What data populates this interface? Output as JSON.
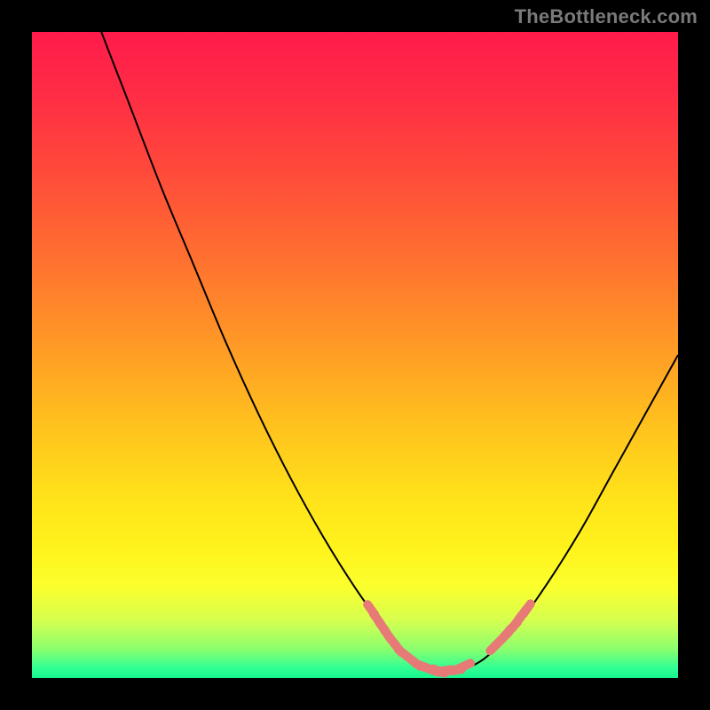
{
  "attribution": "TheBottleneck.com",
  "gradient": {
    "stops": [
      {
        "offset": 0.0,
        "color": "#ff1b4b"
      },
      {
        "offset": 0.1,
        "color": "#ff2d45"
      },
      {
        "offset": 0.22,
        "color": "#ff4b3a"
      },
      {
        "offset": 0.35,
        "color": "#ff7030"
      },
      {
        "offset": 0.48,
        "color": "#ff9826"
      },
      {
        "offset": 0.6,
        "color": "#ffbf1e"
      },
      {
        "offset": 0.72,
        "color": "#ffe21a"
      },
      {
        "offset": 0.8,
        "color": "#fff31c"
      },
      {
        "offset": 0.86,
        "color": "#fbff2e"
      },
      {
        "offset": 0.91,
        "color": "#d6ff4f"
      },
      {
        "offset": 0.955,
        "color": "#8cff6e"
      },
      {
        "offset": 0.985,
        "color": "#2fff94"
      },
      {
        "offset": 1.0,
        "color": "#17f58f"
      }
    ]
  },
  "chart_data": {
    "type": "line",
    "title": "",
    "xlabel": "",
    "ylabel": "",
    "xlim": [
      0,
      100
    ],
    "ylim": [
      0,
      100
    ],
    "grid": false,
    "legend": false,
    "series": [
      {
        "name": "bottleneck-curve",
        "x": [
          0,
          5,
          10,
          15,
          20,
          25,
          30,
          35,
          40,
          45,
          50,
          55,
          57,
          60,
          63,
          66,
          70,
          75,
          80,
          85,
          90,
          95,
          100
        ],
        "y": [
          134,
          116,
          102,
          89,
          76,
          64,
          52,
          41,
          31,
          22,
          14,
          7,
          4.5,
          2.2,
          1.1,
          1.2,
          3,
          8,
          15,
          23,
          32,
          41,
          50
        ]
      }
    ],
    "marker_clusters": [
      {
        "name": "left-falling-markers",
        "color": "#e77a76",
        "points": [
          {
            "x": 52.5,
            "y": 10.6
          },
          {
            "x": 53.4,
            "y": 9.2
          },
          {
            "x": 54.2,
            "y": 8.0
          },
          {
            "x": 55.0,
            "y": 6.8
          },
          {
            "x": 55.8,
            "y": 5.7
          },
          {
            "x": 56.6,
            "y": 4.7
          },
          {
            "x": 57.5,
            "y": 3.8
          }
        ]
      },
      {
        "name": "valley-floor-markers",
        "color": "#e77a76",
        "points": [
          {
            "x": 59.3,
            "y": 2.4
          },
          {
            "x": 60.3,
            "y": 1.9
          },
          {
            "x": 61.2,
            "y": 1.5
          },
          {
            "x": 62.1,
            "y": 1.2
          },
          {
            "x": 63.0,
            "y": 1.1
          },
          {
            "x": 63.9,
            "y": 1.1
          },
          {
            "x": 64.7,
            "y": 1.2
          },
          {
            "x": 65.5,
            "y": 1.3
          },
          {
            "x": 66.2,
            "y": 1.5
          },
          {
            "x": 67.0,
            "y": 1.9
          }
        ]
      },
      {
        "name": "right-rising-markers",
        "color": "#e77a76",
        "points": [
          {
            "x": 71.6,
            "y": 4.9
          },
          {
            "x": 72.3,
            "y": 5.6
          },
          {
            "x": 73.1,
            "y": 6.4
          },
          {
            "x": 73.8,
            "y": 7.2
          },
          {
            "x": 74.5,
            "y": 8.0
          },
          {
            "x": 75.2,
            "y": 8.9
          },
          {
            "x": 75.9,
            "y": 9.8
          },
          {
            "x": 76.6,
            "y": 10.7
          }
        ]
      }
    ]
  }
}
